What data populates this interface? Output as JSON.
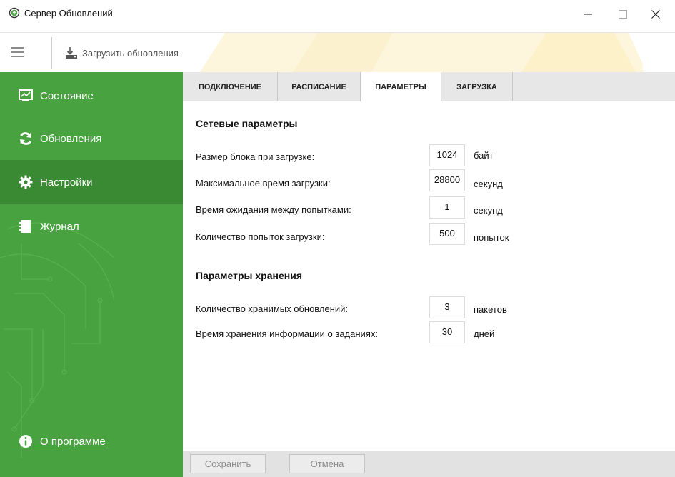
{
  "window": {
    "title": "Сервер Обновлений"
  },
  "toolbar": {
    "load_label": "Загрузить обновления"
  },
  "sidebar": {
    "items": [
      {
        "label": "Состояние",
        "icon": "monitor-icon",
        "active": false
      },
      {
        "label": "Обновления",
        "icon": "refresh-icon",
        "active": false
      },
      {
        "label": "Настройки",
        "icon": "gear-icon",
        "active": true
      },
      {
        "label": "Журнал",
        "icon": "journal-icon",
        "active": false
      }
    ],
    "about_label": "О программе"
  },
  "tabs": [
    {
      "label": "ПОДКЛЮЧЕНИЕ",
      "active": false
    },
    {
      "label": "РАСПИСАНИЕ",
      "active": false
    },
    {
      "label": "ПАРАМЕТРЫ",
      "active": true
    },
    {
      "label": "ЗАГРУЗКА",
      "active": false
    }
  ],
  "network": {
    "title": "Сетевые параметры",
    "rows": [
      {
        "label": "Размер блока при загрузке:",
        "value": "1024",
        "unit": "байт"
      },
      {
        "label": "Максимальное время загрузки:",
        "value": "28800",
        "unit": "секунд"
      },
      {
        "label": "Время ожидания между попытками:",
        "value": "1",
        "unit": "секунд"
      },
      {
        "label": "Количество попыток загрузки:",
        "value": "500",
        "unit": "попыток"
      }
    ]
  },
  "storage": {
    "title": "Параметры хранения",
    "rows": [
      {
        "label": "Количество хранимых обновлений:",
        "value": "3",
        "unit": "пакетов"
      },
      {
        "label": "Время хранения информации о заданиях:",
        "value": "30",
        "unit": "дней"
      }
    ]
  },
  "footer": {
    "save_label": "Сохранить",
    "cancel_label": "Отмена"
  },
  "colors": {
    "sidebar_green": "#47a23f",
    "sidebar_active": "#3a8a33",
    "tabbar_gray": "#e7e7e7",
    "footer_gray": "#e2e2e2"
  }
}
